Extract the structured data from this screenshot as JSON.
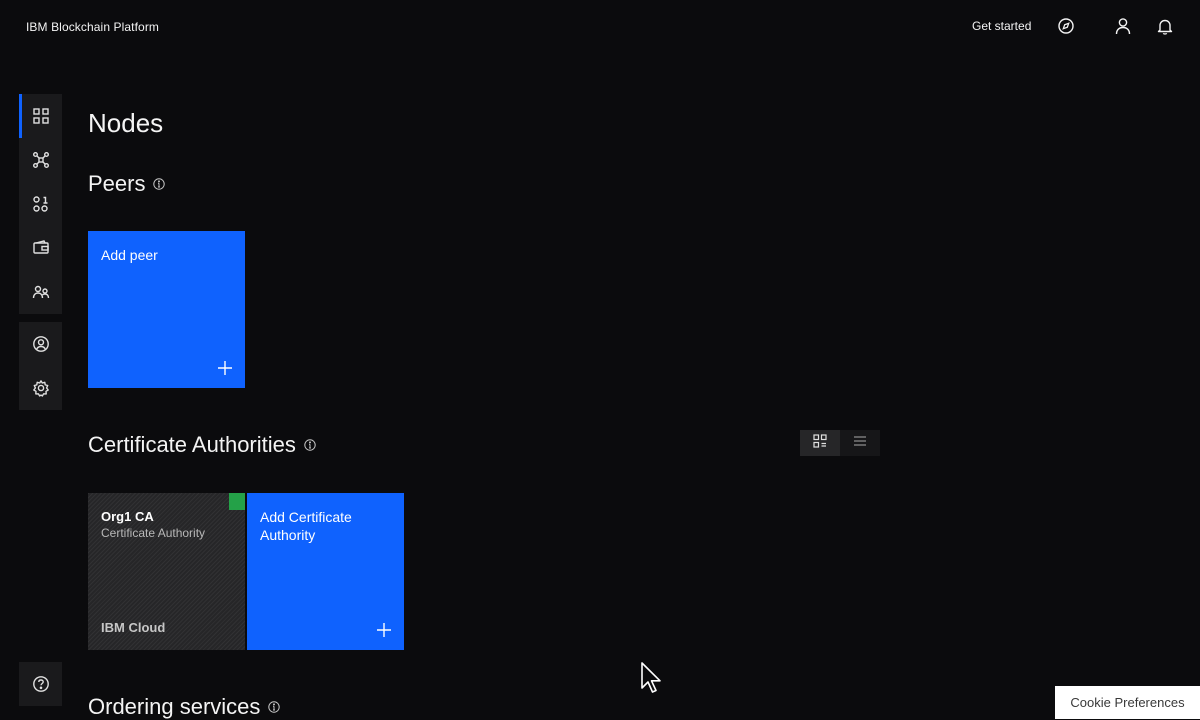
{
  "header": {
    "brand": "IBM Blockchain Platform",
    "get_started": "Get started",
    "icons": [
      "compass-icon",
      "user-icon",
      "notification-icon"
    ]
  },
  "sidebar": {
    "items": [
      {
        "name": "nodes",
        "icon": "grid-icon",
        "active": true
      },
      {
        "name": "channels",
        "icon": "network-icon",
        "active": false
      },
      {
        "name": "smart-contracts",
        "icon": "smart-contract-icon",
        "active": false
      },
      {
        "name": "wallet",
        "icon": "wallet-icon",
        "active": false
      },
      {
        "name": "organizations",
        "icon": "group-icon",
        "active": false
      },
      {
        "name": "users",
        "icon": "user-avatar-icon",
        "active": false
      },
      {
        "name": "settings",
        "icon": "gear-icon",
        "active": false
      },
      {
        "name": "help",
        "icon": "help-icon",
        "active": false
      }
    ]
  },
  "main": {
    "title": "Nodes",
    "peers": {
      "title": "Peers",
      "add_label": "Add peer"
    },
    "certificate_authorities": {
      "title": "Certificate Authorities",
      "nodes": [
        {
          "name": "Org1 CA",
          "type": "Certificate Authority",
          "location": "IBM Cloud",
          "status_color": "#24a148"
        }
      ],
      "add_label": "Add Certificate Authority",
      "view_options": [
        "tile-view-icon",
        "list-view-icon"
      ]
    },
    "ordering_services": {
      "title": "Ordering services"
    }
  },
  "cookie": {
    "label": "Cookie Preferences"
  },
  "colors": {
    "accent": "#0f62fe",
    "background": "#0b0b0d",
    "status_ok": "#24a148"
  }
}
